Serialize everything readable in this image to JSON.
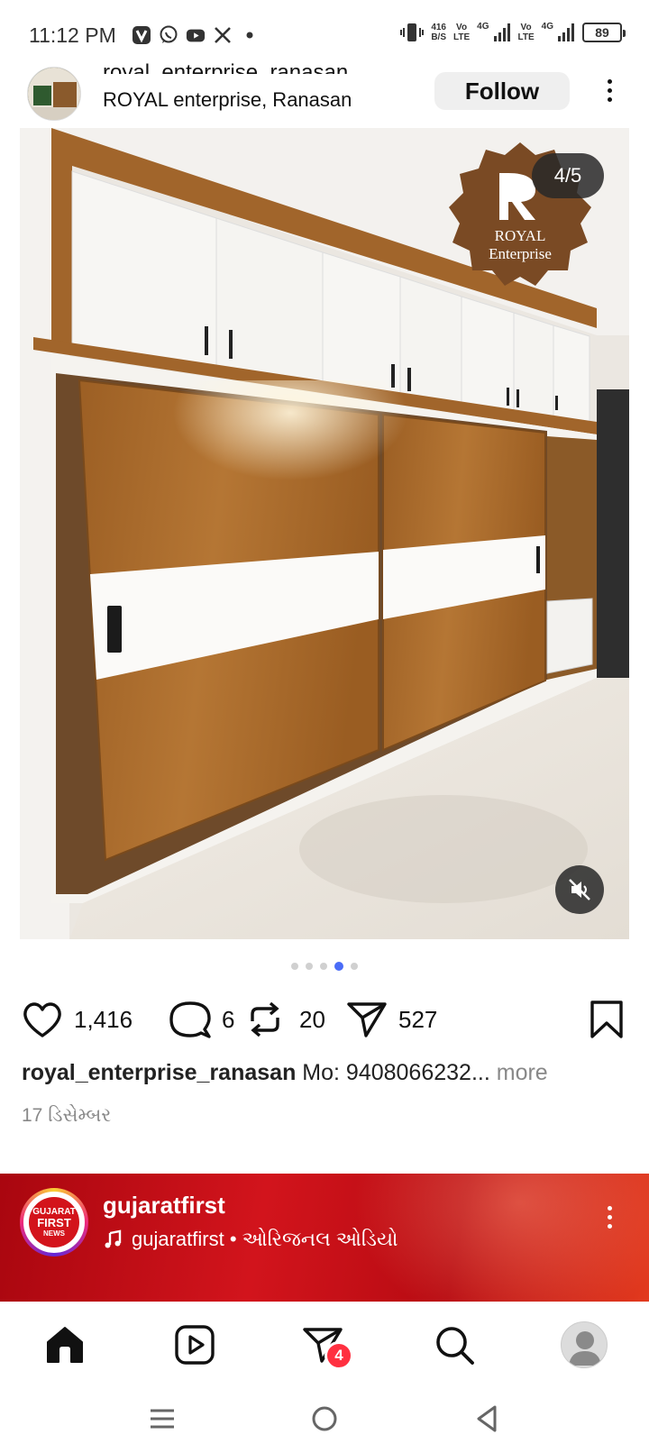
{
  "status_bar": {
    "time": "11:12 PM",
    "net_speed_value": "416",
    "net_speed_unit": "B/S",
    "volte1_top": "Vo",
    "volte1_bottom": "LTE",
    "sig1": "4G",
    "volte2_top": "Vo",
    "volte2_bottom": "LTE",
    "sig2": "4G",
    "battery": "89",
    "app_icons": [
      "v-app-icon",
      "whatsapp-icon",
      "youtube-icon",
      "x-icon",
      "dot-icon"
    ]
  },
  "post": {
    "username_cut": "royal_enterprise_ranasan",
    "location": "ROYAL enterprise, Ranasan",
    "follow_label": "Follow",
    "counter": "4/5",
    "logo_line1": "ROYAL",
    "logo_line2": "Enterprise",
    "carousel": {
      "total": 5,
      "active": 4
    },
    "likes": "1,416",
    "comments": "6",
    "reposts": "20",
    "shares": "527",
    "caption_user": "royal_enterprise_ranasan",
    "caption_text": "Mo: 9408066232...",
    "caption_more": "more",
    "date": "17 ડિસેમ્બર"
  },
  "next_post": {
    "username": "gujaratfirst",
    "audio": "gujaratfirst • ઓરિજનલ ઓડિયો",
    "logo_line1": "GUJARAT",
    "logo_line2": "FIRST",
    "logo_line3": "NEWS"
  },
  "bottom_nav": {
    "items": [
      "home-icon",
      "reels-icon",
      "send-icon",
      "search-icon",
      "profile-avatar"
    ],
    "notification_badge": "4"
  },
  "colors": {
    "accent": "#4a6cf7",
    "badge": "#ff3040",
    "banner_red": "#c20d15",
    "wood": "#a2672b"
  }
}
